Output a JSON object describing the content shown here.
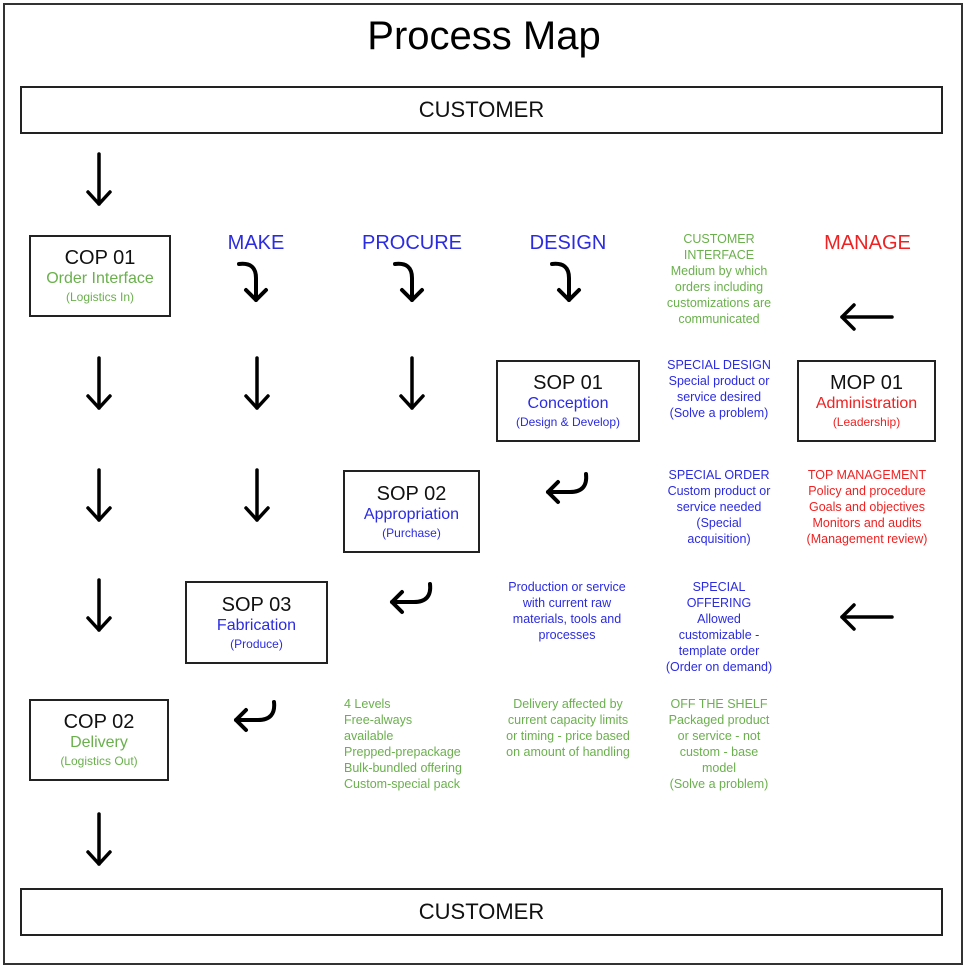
{
  "title": "Process Map",
  "customer_top": "CUSTOMER",
  "customer_bottom": "CUSTOMER",
  "colors": {
    "customer_green": "#6ab04c",
    "support_blue": "#2b2be0",
    "manage_red": "#ee2222",
    "border": "#222222"
  },
  "headers": {
    "make": "MAKE",
    "procure": "PROCURE",
    "design": "DESIGN",
    "manage": "MANAGE"
  },
  "boxes": {
    "cop01": {
      "code": "COP 01",
      "name": "Order Interface",
      "sub": "(Logistics In)"
    },
    "sop01": {
      "code": "SOP 01",
      "name": "Conception",
      "sub": "(Design & Develop)"
    },
    "mop01": {
      "code": "MOP 01",
      "name": "Administration",
      "sub": "(Leadership)"
    },
    "sop02": {
      "code": "SOP 02",
      "name": "Appropriation",
      "sub": "(Purchase)"
    },
    "sop03": {
      "code": "SOP 03",
      "name": "Fabrication",
      "sub": "(Produce)"
    },
    "cop02": {
      "code": "COP 02",
      "name": "Delivery",
      "sub": "(Logistics Out)"
    }
  },
  "notes": {
    "customer_interface": "CUSTOMER\nINTERFACE\nMedium by which\norders including\ncustomizations are\ncommunicated",
    "special_design": "SPECIAL DESIGN\nSpecial product or\nservice desired\n(Solve a problem)",
    "special_order": "SPECIAL ORDER\nCustom product or\nservice needed\n(Special\nacquisition)",
    "top_management": "TOP MANAGEMENT\nPolicy and procedure\nGoals and objectives\nMonitors and audits\n(Management review)",
    "production": "Production or service\nwith current raw\nmaterials, tools and\nprocesses",
    "special_offering": "SPECIAL\nOFFERING\nAllowed\ncustomizable -\ntemplate order\n(Order on demand)",
    "levels": "4 Levels\nFree-always\navailable\nPrepped-prepackage\nBulk-bundled offering\nCustom-special pack",
    "delivery_affected": "Delivery affected by\ncurrent capacity limits\nor timing - price based\non amount of handling",
    "off_the_shelf": "OFF THE SHELF\nPackaged product\nor service - not\ncustom   - base\nmodel\n(Solve a problem)"
  }
}
